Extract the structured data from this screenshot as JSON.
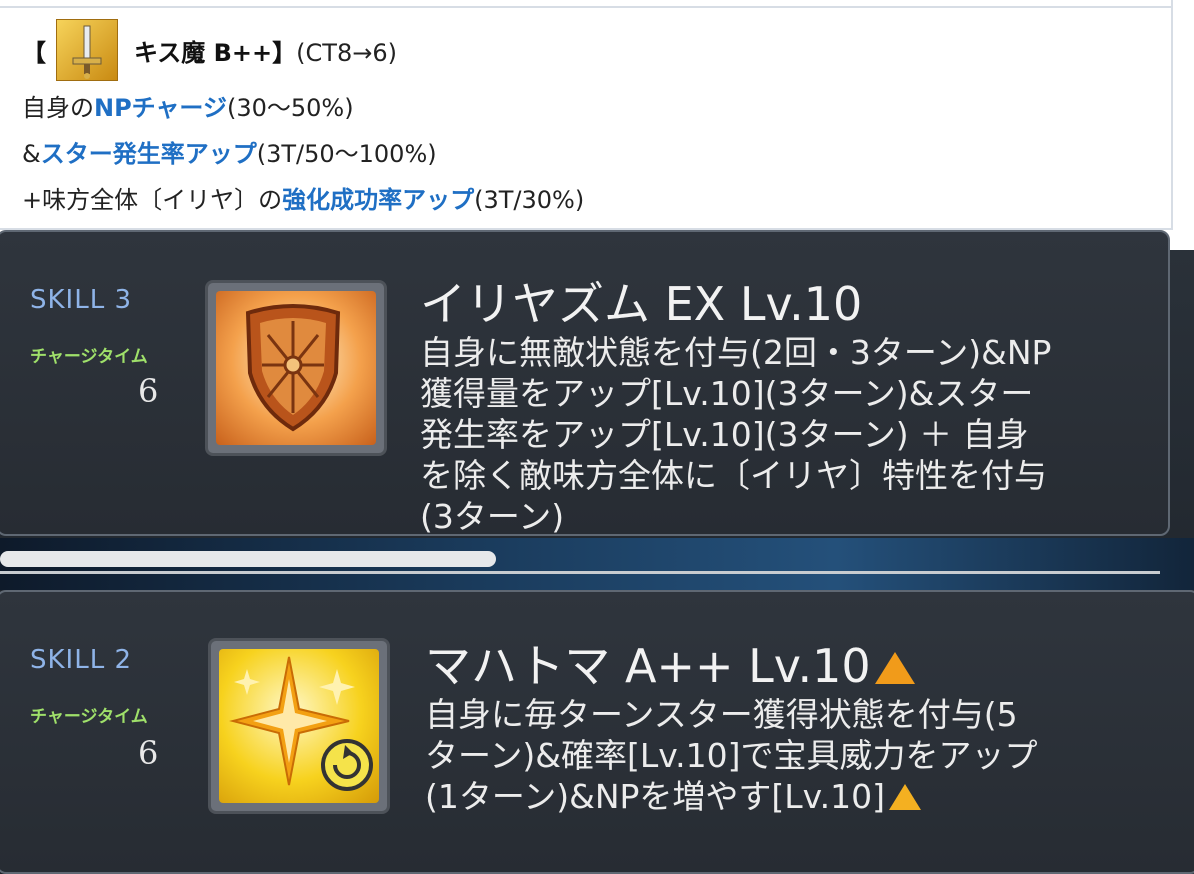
{
  "wiki": {
    "bracket_open": "【",
    "skill_name": "キス魔 B++】",
    "ct": "(CT8→6)",
    "line1_pre": "自身の",
    "line1_link": "NPチャージ",
    "line1_post": "(30〜50%)",
    "line2_pre": "&",
    "line2_link": "スター発生率アップ",
    "line2_post": "(3T/50〜100%)",
    "line3_pre": "+味方全体〔イリヤ〕の",
    "line3_link": "強化成功率アップ",
    "line3_post": "(3T/30%)",
    "icon": "sword-icon"
  },
  "skill3": {
    "label": "SKILL 3",
    "ct_label": "チャージタイム",
    "ct_value": "6",
    "icon": "shield-icon",
    "title": "イリヤズム EX Lv.10",
    "desc": [
      "自身に無敵状態を付与(2回・3ターン)&NP",
      "獲得量をアップ[Lv.10](3ターン)&スター",
      "発生率をアップ[Lv.10](3ターン) ＋ 自身",
      "を除く敵味方全体に〔イリヤ〕特性を付与",
      "(3ターン)"
    ]
  },
  "skill2": {
    "label": "SKILL 2",
    "ct_label": "チャージタイム",
    "ct_value": "6",
    "icon": "sparkle-star-icon",
    "title": "マハトマ A++ Lv.10",
    "desc": [
      "自身に毎ターンスター獲得状態を付与(5",
      "ターン)&確率[Lv.10]で宝具威力をアップ",
      "(1ターン)&NPを増やす[Lv.10]"
    ]
  },
  "colors": {
    "link": "#1f6fc4",
    "ct_label": "#9fe06a",
    "skill_label": "#8fb4e8",
    "upgrade": "#f19b1a"
  }
}
